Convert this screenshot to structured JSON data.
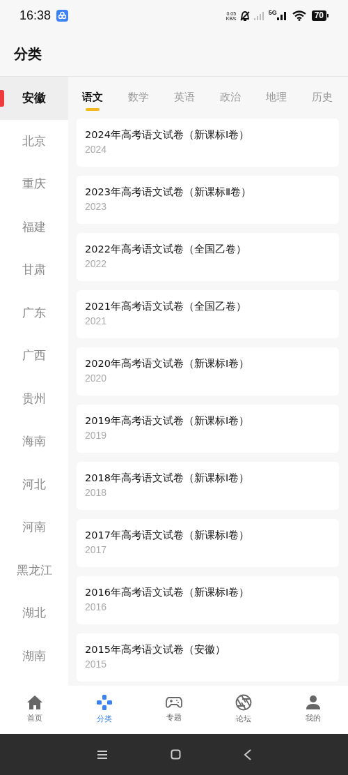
{
  "status_bar": {
    "time": "16:38",
    "speed": "0.05\nKB/s",
    "network": "5G",
    "battery": "70"
  },
  "header": {
    "title": "分类"
  },
  "sidebar": {
    "items": [
      {
        "label": "安徽",
        "selected": true
      },
      {
        "label": "北京",
        "selected": false
      },
      {
        "label": "重庆",
        "selected": false
      },
      {
        "label": "福建",
        "selected": false
      },
      {
        "label": "甘肃",
        "selected": false
      },
      {
        "label": "广东",
        "selected": false
      },
      {
        "label": "广西",
        "selected": false
      },
      {
        "label": "贵州",
        "selected": false
      },
      {
        "label": "海南",
        "selected": false
      },
      {
        "label": "河北",
        "selected": false
      },
      {
        "label": "河南",
        "selected": false
      },
      {
        "label": "黑龙江",
        "selected": false
      },
      {
        "label": "湖北",
        "selected": false
      },
      {
        "label": "湖南",
        "selected": false
      }
    ]
  },
  "tabs": [
    {
      "label": "语文",
      "selected": true
    },
    {
      "label": "数学",
      "selected": false
    },
    {
      "label": "英语",
      "selected": false
    },
    {
      "label": "政治",
      "selected": false
    },
    {
      "label": "地理",
      "selected": false
    },
    {
      "label": "历史",
      "selected": false
    }
  ],
  "papers": [
    {
      "title": "2024年高考语文试卷（新课标Ⅰ卷）",
      "year": "2024"
    },
    {
      "title": "2023年高考语文试卷（新课标Ⅱ卷）",
      "year": "2023"
    },
    {
      "title": "2022年高考语文试卷（全国乙卷）",
      "year": "2022"
    },
    {
      "title": "2021年高考语文试卷（全国乙卷）",
      "year": "2021"
    },
    {
      "title": "2020年高考语文试卷（新课标Ⅰ卷）",
      "year": "2020"
    },
    {
      "title": "2019年高考语文试卷（新课标Ⅰ卷）",
      "year": "2019"
    },
    {
      "title": "2018年高考语文试卷（新课标Ⅰ卷）",
      "year": "2018"
    },
    {
      "title": "2017年高考语文试卷（新课标Ⅰ卷）",
      "year": "2017"
    },
    {
      "title": "2016年高考语文试卷（新课标Ⅰ卷）",
      "year": "2016"
    },
    {
      "title": "2015年高考语文试卷（安徽）",
      "year": "2015"
    }
  ],
  "bottom_nav": [
    {
      "label": "首页",
      "kind": "home",
      "selected": false
    },
    {
      "label": "分类",
      "kind": "category",
      "selected": true
    },
    {
      "label": "专题",
      "kind": "gamepad",
      "selected": false
    },
    {
      "label": "论坛",
      "kind": "aperture",
      "selected": false
    },
    {
      "label": "我的",
      "kind": "person",
      "selected": false
    }
  ]
}
